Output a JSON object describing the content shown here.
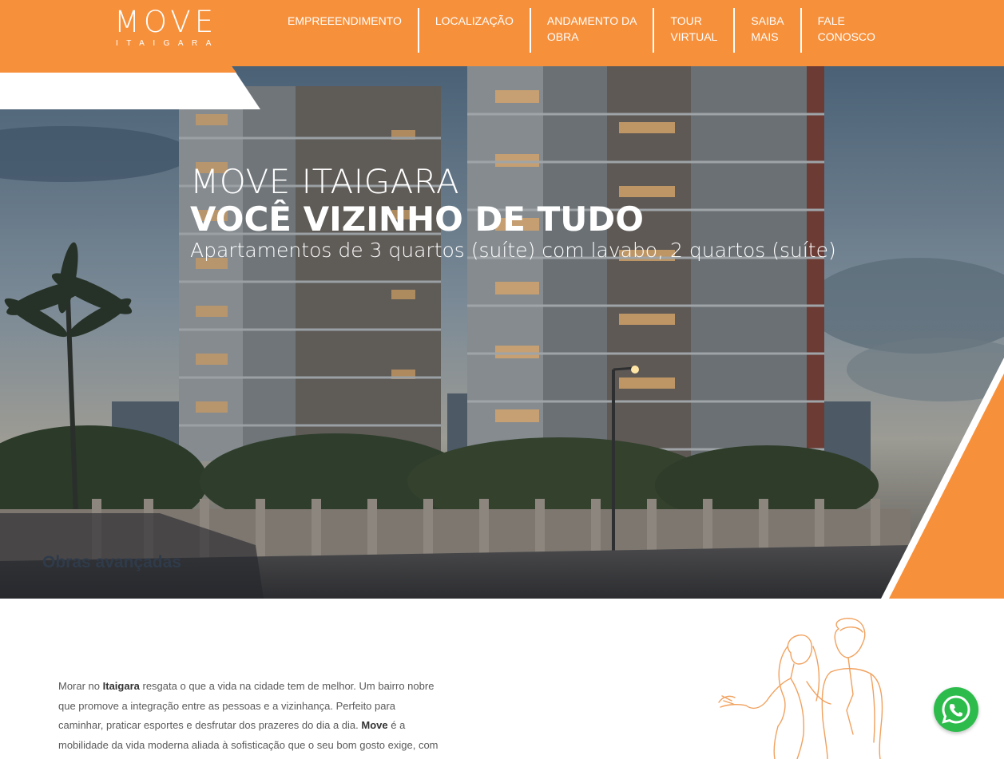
{
  "header": {
    "logo_main": "MOVE",
    "logo_sub": "ITAIGARA",
    "nav": [
      {
        "line1": "EMPREEENDIMENTO",
        "line2": ""
      },
      {
        "line1": "LOCALIZAÇÃO",
        "line2": ""
      },
      {
        "line1": "ANDAMENTO DA",
        "line2": "OBRA"
      },
      {
        "line1": "TOUR",
        "line2": "VIRTUAL"
      },
      {
        "line1": "SAIBA",
        "line2": "MAIS"
      },
      {
        "line1": "FALE",
        "line2": "CONOSCO"
      }
    ]
  },
  "hero": {
    "title": "MOVE ITAIGARA",
    "subtitle": "VOCÊ VIZINHO DE TUDO",
    "description": "Apartamentos de 3 quartos (suíte) com lavabo, 2 quartos (suíte)",
    "badge": "Obras avançadas"
  },
  "intro": {
    "t1": "Morar no ",
    "b1": "Itaigara",
    "t2": " resgata o que a vida na cidade tem de melhor. Um bairro nobre que promove a integração entre as pessoas e a vizinhança. Perfeito para caminhar, praticar esportes e desfrutar dos prazeres do dia a dia. ",
    "b2": "Move",
    "t3": " é a mobilidade da vida moderna aliada à sofisticação que o seu bom gosto exige, com a assinatura"
  },
  "colors": {
    "brand_orange": "#f7903b",
    "whatsapp_green": "#2dbc4c",
    "badge_text": "#2f3b4a"
  },
  "icons": {
    "whatsapp": "whatsapp-icon",
    "illustration": "couple-line-illustration"
  }
}
